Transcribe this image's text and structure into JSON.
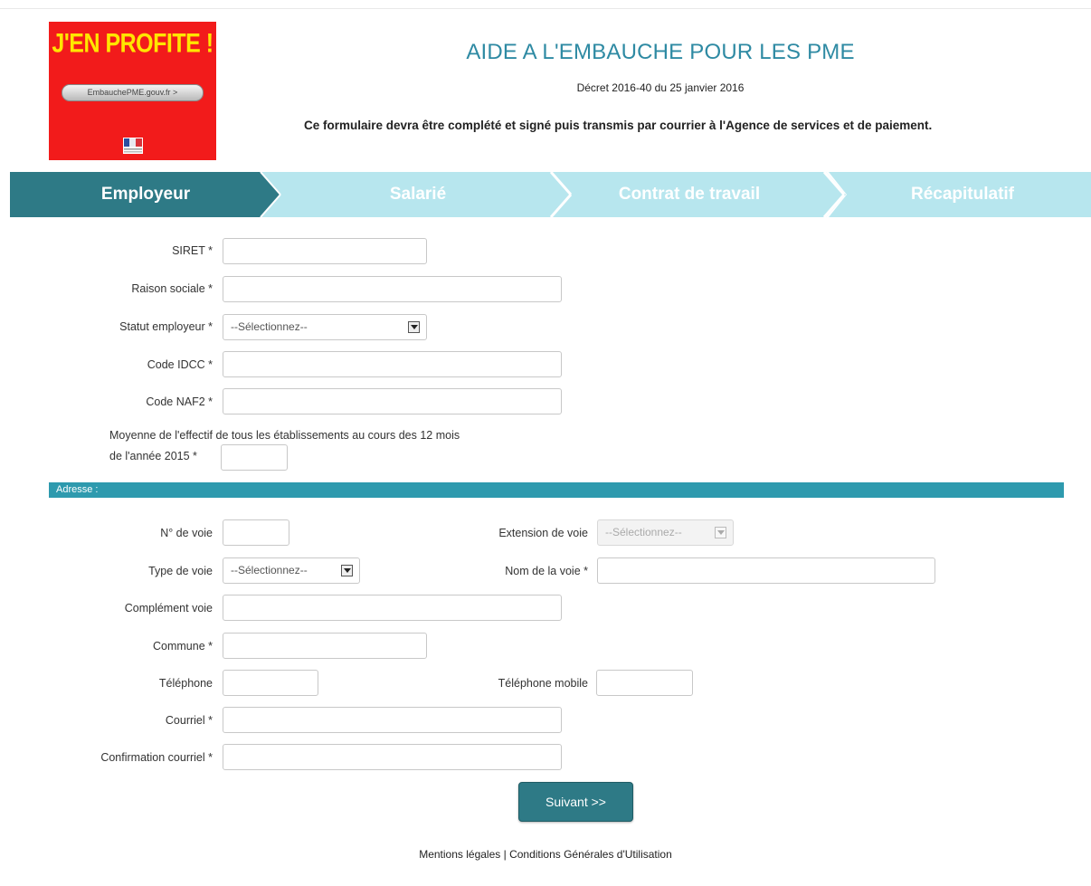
{
  "logo": {
    "headline": "J'EN PROFITE !",
    "url_pill": "EmbauchePME.gouv.fr >",
    "colors": {
      "background": "#f21b1b",
      "headline": "#ffe600"
    }
  },
  "header": {
    "title": "AIDE A L'EMBAUCHE POUR LES PME",
    "decree": "Décret 2016-40 du 25 janvier 2016",
    "notice": "Ce formulaire devra être complété et signé puis transmis par courrier à l'Agence de services et de paiement."
  },
  "steps": [
    {
      "label": "Employeur",
      "active": true
    },
    {
      "label": "Salarié",
      "active": false
    },
    {
      "label": "Contrat de travail",
      "active": false
    },
    {
      "label": "Récapitulatif",
      "active": false
    }
  ],
  "colors": {
    "active_step": "#2e7a86",
    "inactive_step": "#b7e6ee",
    "section_bar": "#2e9aae"
  },
  "employer": {
    "siret_label": "SIRET *",
    "raison_label": "Raison sociale *",
    "statut_label": "Statut employeur *",
    "statut_value": "--Sélectionnez--",
    "idcc_label": "Code IDCC *",
    "naf_label": "Code NAF2 *",
    "effectif_label_1": "Moyenne de l'effectif de tous les établissements au cours des 12 mois",
    "effectif_label_2": "de l'année 2015 *"
  },
  "address": {
    "section_title": "Adresse :",
    "numero_label": "N° de voie",
    "extension_label": "Extension de voie",
    "extension_value": "--Sélectionnez--",
    "type_label": "Type de voie",
    "type_value": "--Sélectionnez--",
    "nom_label": "Nom de la voie *",
    "complement_label": "Complément voie",
    "commune_label": "Commune *",
    "telephone_label": "Téléphone",
    "mobile_label": "Téléphone mobile",
    "courriel_label": "Courriel *",
    "confirmation_label": "Confirmation courriel *"
  },
  "actions": {
    "next_label": "Suivant >>"
  },
  "footer": {
    "mentions": "Mentions légales",
    "separator": " | ",
    "cgu": "Conditions Générales d'Utilisation"
  }
}
